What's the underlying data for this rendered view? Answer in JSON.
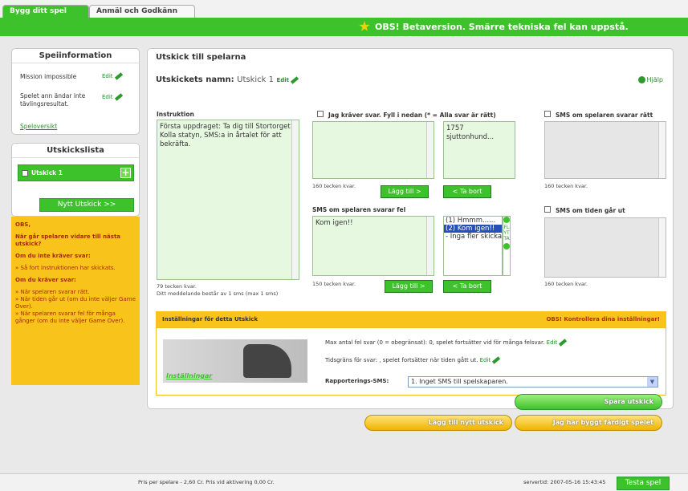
{
  "tabs": {
    "build": "Bygg ditt spel",
    "report": "Anmäl och Godkänn"
  },
  "beta_text": "OBS! Betaversion. Smärre tekniska fel kan uppstå.",
  "info": {
    "title": "Speiinformation",
    "mission": "Mission impossible",
    "mission_edit": "Edit",
    "rule": "Spelet ann ändar inte tävlingsresultat.",
    "rule_edit": "Edit",
    "overview": "Speloversikt"
  },
  "send_list": {
    "title": "Utskickslista",
    "item": "Utskick 1",
    "new_button": "Nytt Utskick >>"
  },
  "obs": {
    "title": "OBS,",
    "q1": "När går spelaren vidare till nästa utskick?",
    "h2": "Om du inte kräver svar:",
    "p2": "» Så fort instruktionen har skickats.",
    "h3": "Om du kräver svar:",
    "p3": "» När spelaren svarar rätt.\n» När tiden går ut (om du inte väljer Game Over).\n» När spelaren svarar fel för många gånger (om du inte väljer Game Over)."
  },
  "main": {
    "title": "Utskick till spelarna",
    "name_label": "Utskickets namn:",
    "name_value": "Utskick 1",
    "name_edit": "Edit",
    "help": "Hjälp",
    "instruction_label": "Instruktion",
    "instruction_text": "Första uppdraget: Ta dig till Stortorget! Kolla statyn, SMS:a in årtalet för att bekräfta.",
    "instruction_count": "79 tecken kvar.",
    "instruction_note": "Ditt meddelande består av 1 sms (max 1 sms)",
    "require_label": "Jag kräver svar. Fyll i nedan (* = Alla svar är rätt)",
    "answers": [
      "1757",
      "sjuttonhund..."
    ],
    "answer_count": "160 tecken kvar.",
    "add_btn": "Lägg till >",
    "remove_btn": "< Ta bort",
    "wrong_label": "SMS om spelaren svarar fel",
    "wrong_text": "Kom igen!!",
    "wrong_count": "150 tecken kvar.",
    "wrong_list": [
      "(1) Hmmm......",
      "(2) Kom igen!!",
      "- Inga fler skickas -"
    ],
    "flip_label": "FLYTTA",
    "right_label": "SMS om spelaren svarar rätt",
    "right_count": "160 tecken kvar.",
    "timeout_label": "SMS om tiden går ut",
    "timeout_count": "160 tecken kvar."
  },
  "settings": {
    "title": "Inställningar för detta Utskick",
    "warning": "OBS! Kontrollera dina inställningar!",
    "image_label": "Inställningar",
    "max_wrong": "Max antal fel svar (0 = obegränsat): 0, spelet fortsätter vid för många felsvar.",
    "max_wrong_edit": "Edit",
    "time_limit": "Tidsgräns för svar: , spelet fortsätter när tiden gått ut.",
    "time_limit_edit": "Edit",
    "report_label": "Rapporterings-SMS:",
    "report_value": "1. Inget SMS till spelskaparen."
  },
  "actions": {
    "new_send": "Spara utskick",
    "add_new": "Lägg till nytt utskick",
    "done": "Jag har byggt färdigt spelet"
  },
  "footer": {
    "price": "Pris per spelare - 2,60 Cr. Pris vid aktivering 0,00 Cr.",
    "server_time": "servertid: 2007-05-16 15:43:45",
    "test_button": "Testa spel"
  },
  "colors": {
    "green": "#3ec22c",
    "yellow": "#f8c41c"
  }
}
